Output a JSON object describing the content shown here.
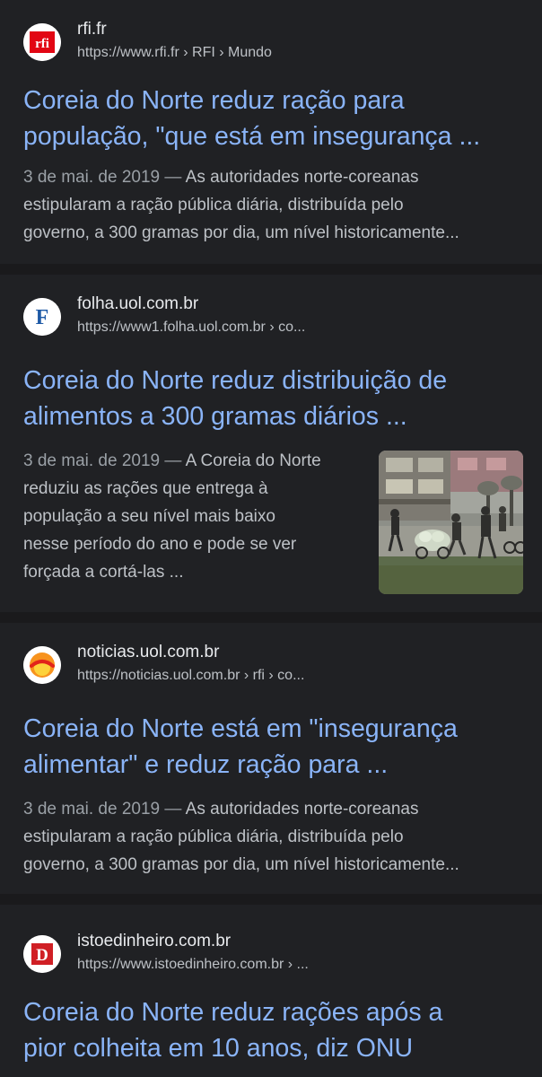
{
  "results": [
    {
      "site_name": "rfi.fr",
      "url": "https://www.rfi.fr › RFI › Mundo",
      "favicon": "rfi-logo-icon",
      "favicon_text": "rfi",
      "title_lines": [
        "Coreia do Norte reduz ração para",
        "população, \"que está em insegurança ..."
      ],
      "date": "3 de mai. de 2019",
      "snippet_first": "As autoridades norte-coreanas",
      "snippet_lines": [
        "estipularam a ração pública diária, distribuída pelo",
        "governo, a 300 gramas por dia, um nível historicamente..."
      ]
    },
    {
      "site_name": "folha.uol.com.br",
      "url": "https://www1.folha.uol.com.br › co...",
      "favicon": "folha-logo-icon",
      "favicon_text": "F",
      "title_lines": [
        "Coreia do Norte reduz distribuição de",
        "alimentos a 300 gramas diários ..."
      ],
      "date": "3 de mai. de 2019",
      "snippet_first": "A Coreia do Norte",
      "snippet_lines": [
        "reduziu as rações que entrega à",
        "população a seu nível mais baixo",
        "nesse período do ano e pode se ver",
        "forçada a cortá-las ..."
      ],
      "thumbnail": "people-pushing-cart-photo"
    },
    {
      "site_name": "noticias.uol.com.br",
      "url": "https://noticias.uol.com.br › rfi › co...",
      "favicon": "uol-logo-icon",
      "title_lines": [
        "Coreia do Norte está em \"insegurança",
        "alimentar\" e reduz ração para ..."
      ],
      "date": "3 de mai. de 2019",
      "snippet_first": "As autoridades norte-coreanas",
      "snippet_lines": [
        "estipularam a ração pública diária, distribuída pelo",
        "governo, a 300 gramas por dia, um nível historicamente..."
      ]
    },
    {
      "site_name": "istoedinheiro.com.br",
      "url": "https://www.istoedinheiro.com.br › ...",
      "favicon": "istoe-dinheiro-logo-icon",
      "favicon_text": "D",
      "title_lines": [
        "Coreia do Norte reduz rações após a",
        "pior colheita em 10 anos, diz ONU"
      ]
    }
  ],
  "separator": "—",
  "colors": {
    "background": "#202124",
    "divider": "#1a1a1c",
    "title_link": "#8ab4f8",
    "text": "#bdc1c6",
    "date": "#9aa0a6",
    "rfi_red": "#e20613",
    "folha_blue": "#1f5aa6",
    "uol_orange": "#f7931e",
    "istoe_red": "#d01f25"
  }
}
